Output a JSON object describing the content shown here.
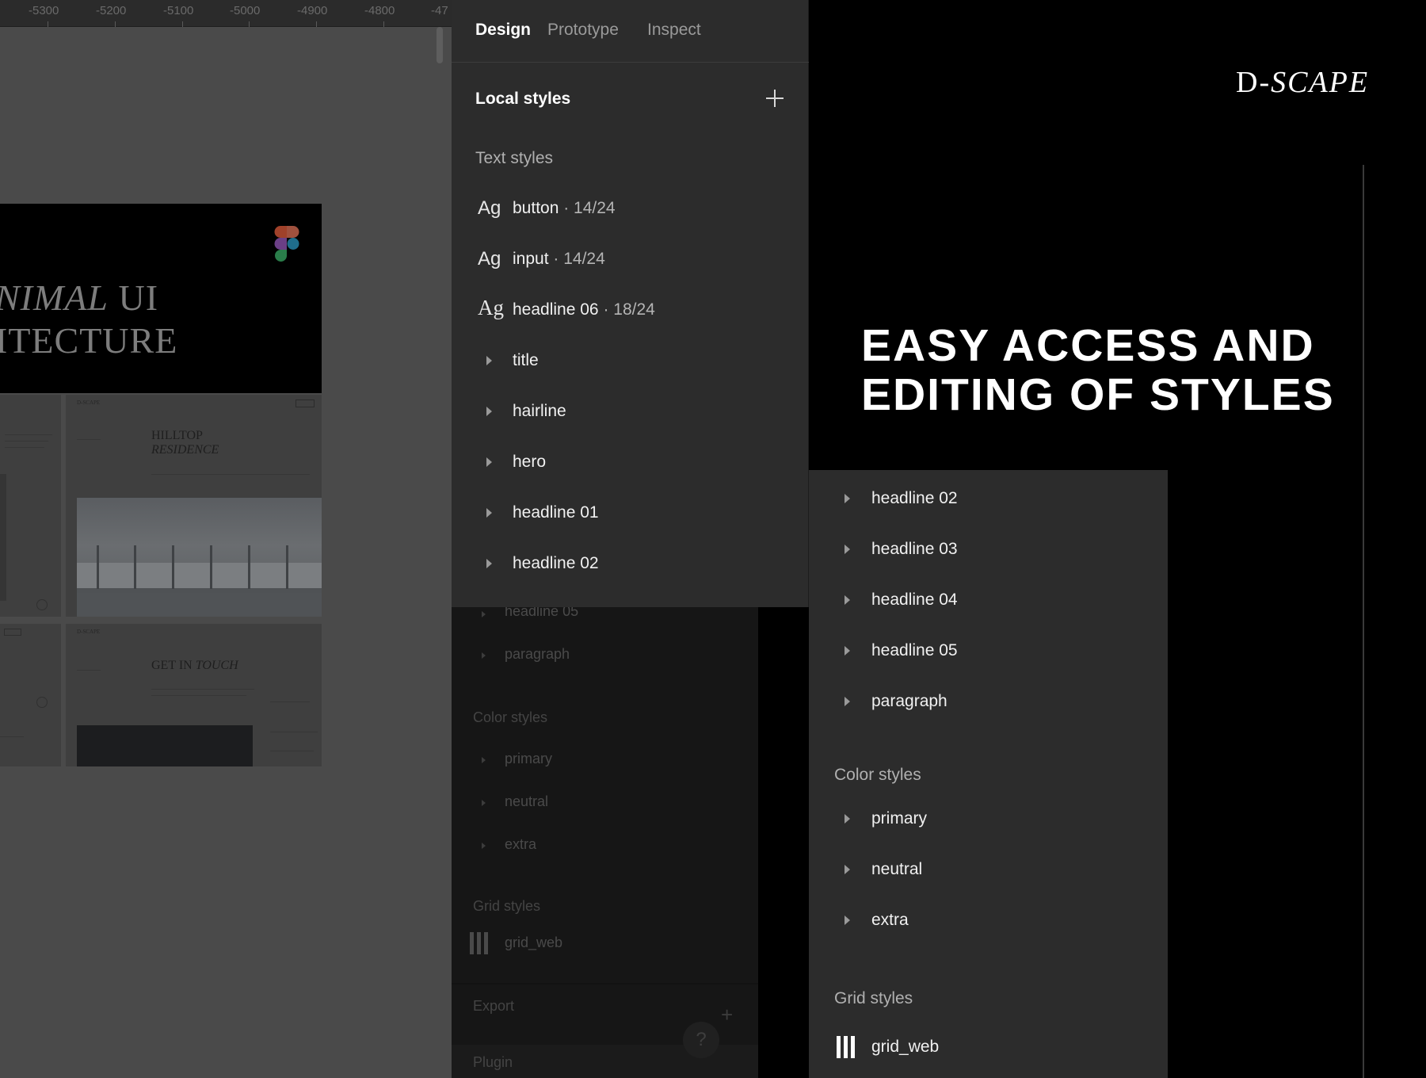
{
  "ruler": {
    "ticks": [
      "-5300",
      "-5200",
      "-5100",
      "-5000",
      "-4900",
      "-4800",
      "-47"
    ]
  },
  "canvas": {
    "hero_line1_italic": "NIMAL",
    "hero_line1_rest": " UI",
    "hero_line2": "ITECTURE",
    "thumb_brand_1": "D-SCAPE",
    "thumb_title_1a": "HILLTOP",
    "thumb_title_1b": "RESIDENCE",
    "thumb_brand_2": "D-SCAPE",
    "thumb_title_2a": "GET IN ",
    "thumb_title_2b": "TOUCH"
  },
  "tabs": [
    "Design",
    "Prototype",
    "Inspect"
  ],
  "panel": {
    "local_styles": "Local styles",
    "text_styles": "Text styles",
    "text_style_items": [
      {
        "sample": "Ag",
        "name": "button",
        "size": " · 14/24"
      },
      {
        "sample": "Ag",
        "name": "input",
        "size": " · 14/24"
      },
      {
        "sample": "Ag",
        "name": "headline 06",
        "size": " · 18/24"
      }
    ],
    "groups": [
      "title",
      "hairline",
      "hero",
      "headline 01",
      "headline 02"
    ]
  },
  "dimmed": {
    "items_top": [
      "headline 05",
      "paragraph"
    ],
    "color_styles": "Color styles",
    "color_items": [
      "primary",
      "neutral",
      "extra"
    ],
    "grid_styles": "Grid styles",
    "grid_item": "grid_web",
    "export": "Export",
    "plugin": "Plugin",
    "help": "?"
  },
  "right": {
    "logo_prefix": "D-",
    "logo_italic": "SCAPE",
    "headline_line1": "EASY ACCESS AND",
    "headline_line2": "EDITING OF STYLES"
  },
  "panel2": {
    "groups": [
      "headline 02",
      "headline 03",
      "headline 04",
      "headline 05",
      "paragraph"
    ],
    "color_styles": "Color styles",
    "color_items": [
      "primary",
      "neutral",
      "extra"
    ],
    "grid_styles": "Grid styles",
    "grid_item": "grid_web"
  }
}
